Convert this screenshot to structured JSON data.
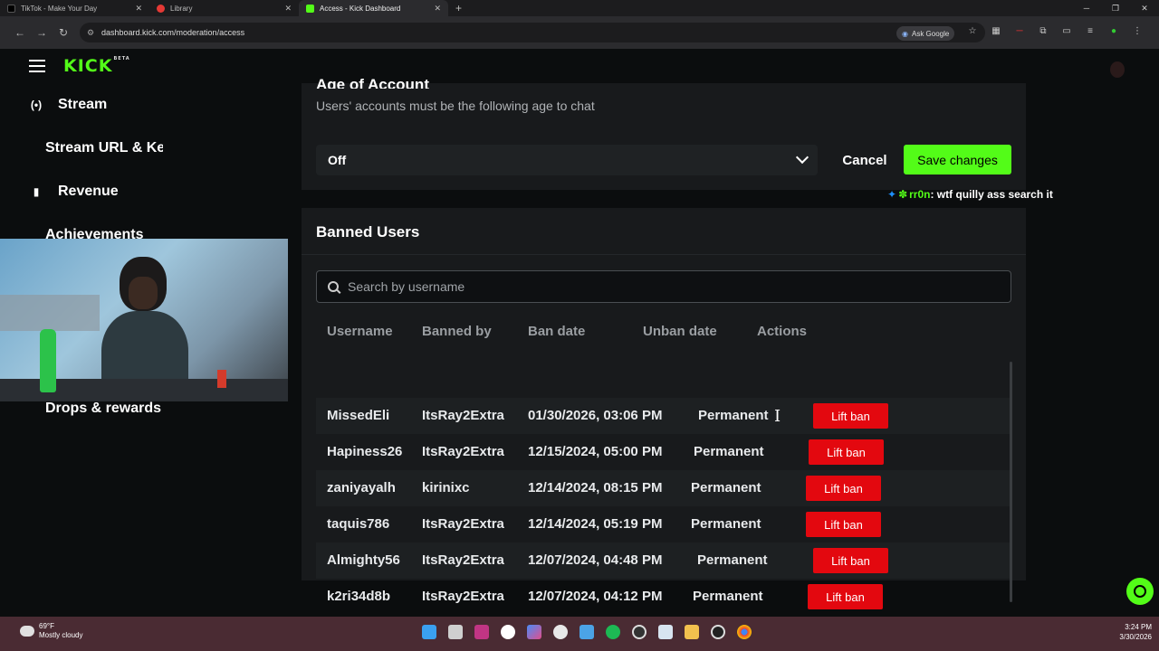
{
  "browser": {
    "tabs": [
      {
        "title": "TikTok - Make Your Day",
        "favicon_color": "#000000",
        "active": false
      },
      {
        "title": "Library",
        "favicon_color": "#e53935",
        "active": false
      },
      {
        "title": "Access - Kick Dashboard",
        "favicon_color": "#53fc18",
        "active": true
      }
    ],
    "url": "dashboard.kick.com/moderation/access",
    "ask_google": "Ask Google"
  },
  "app": {
    "logo": "KICK",
    "logo_badge": "BETA"
  },
  "sidebar": {
    "items": [
      {
        "label": "Stream",
        "icon": "broadcast-icon"
      },
      {
        "label": "Stream URL & Key",
        "icon": ""
      },
      {
        "label": "Revenue",
        "icon": "bar-chart-icon"
      },
      {
        "label": "Achievements",
        "icon": ""
      },
      {
        "label": "Drops & rewards",
        "icon": ""
      }
    ]
  },
  "age_section": {
    "title": "Age of Account",
    "subtitle": "Users' accounts must be the following age to chat",
    "selected": "Off",
    "cancel_label": "Cancel",
    "save_label": "Save changes"
  },
  "chat_overlay": {
    "user": "rr0n",
    "message": ": wtf quilly ass search it"
  },
  "banned": {
    "title": "Banned Users",
    "search_placeholder": "Search by username",
    "columns": [
      "Username",
      "Banned by",
      "Ban date",
      "Unban date",
      "Actions"
    ],
    "action_label": "Lift ban",
    "rows": [
      {
        "username": "MissedEli",
        "banned_by": "ItsRay2Extra",
        "ban_date": "01/30/2026, 03:06 PM",
        "unban_date": "Permanent"
      },
      {
        "username": "Hapiness26",
        "banned_by": "ItsRay2Extra",
        "ban_date": "12/15/2024, 05:00 PM",
        "unban_date": "Permanent"
      },
      {
        "username": "zaniyayalh",
        "banned_by": "kirinixc",
        "ban_date": "12/14/2024, 08:15 PM",
        "unban_date": "Permanent"
      },
      {
        "username": "taquis786",
        "banned_by": "ItsRay2Extra",
        "ban_date": "12/14/2024, 05:19 PM",
        "unban_date": "Permanent"
      },
      {
        "username": "Almighty56",
        "banned_by": "ItsRay2Extra",
        "ban_date": "12/07/2024, 04:48 PM",
        "unban_date": "Permanent"
      },
      {
        "username": "k2ri34d8b",
        "banned_by": "ItsRay2Extra",
        "ban_date": "12/07/2024, 04:12 PM",
        "unban_date": "Permanent"
      }
    ]
  },
  "taskbar": {
    "temperature": "69°F",
    "weather": "Mostly cloudy",
    "time": "3:24 PM",
    "date": "3/30/2026"
  },
  "colors": {
    "accent": "#53fc18",
    "danger": "#e3080f",
    "panel": "#181a1c",
    "background": "#0b0d0e"
  }
}
